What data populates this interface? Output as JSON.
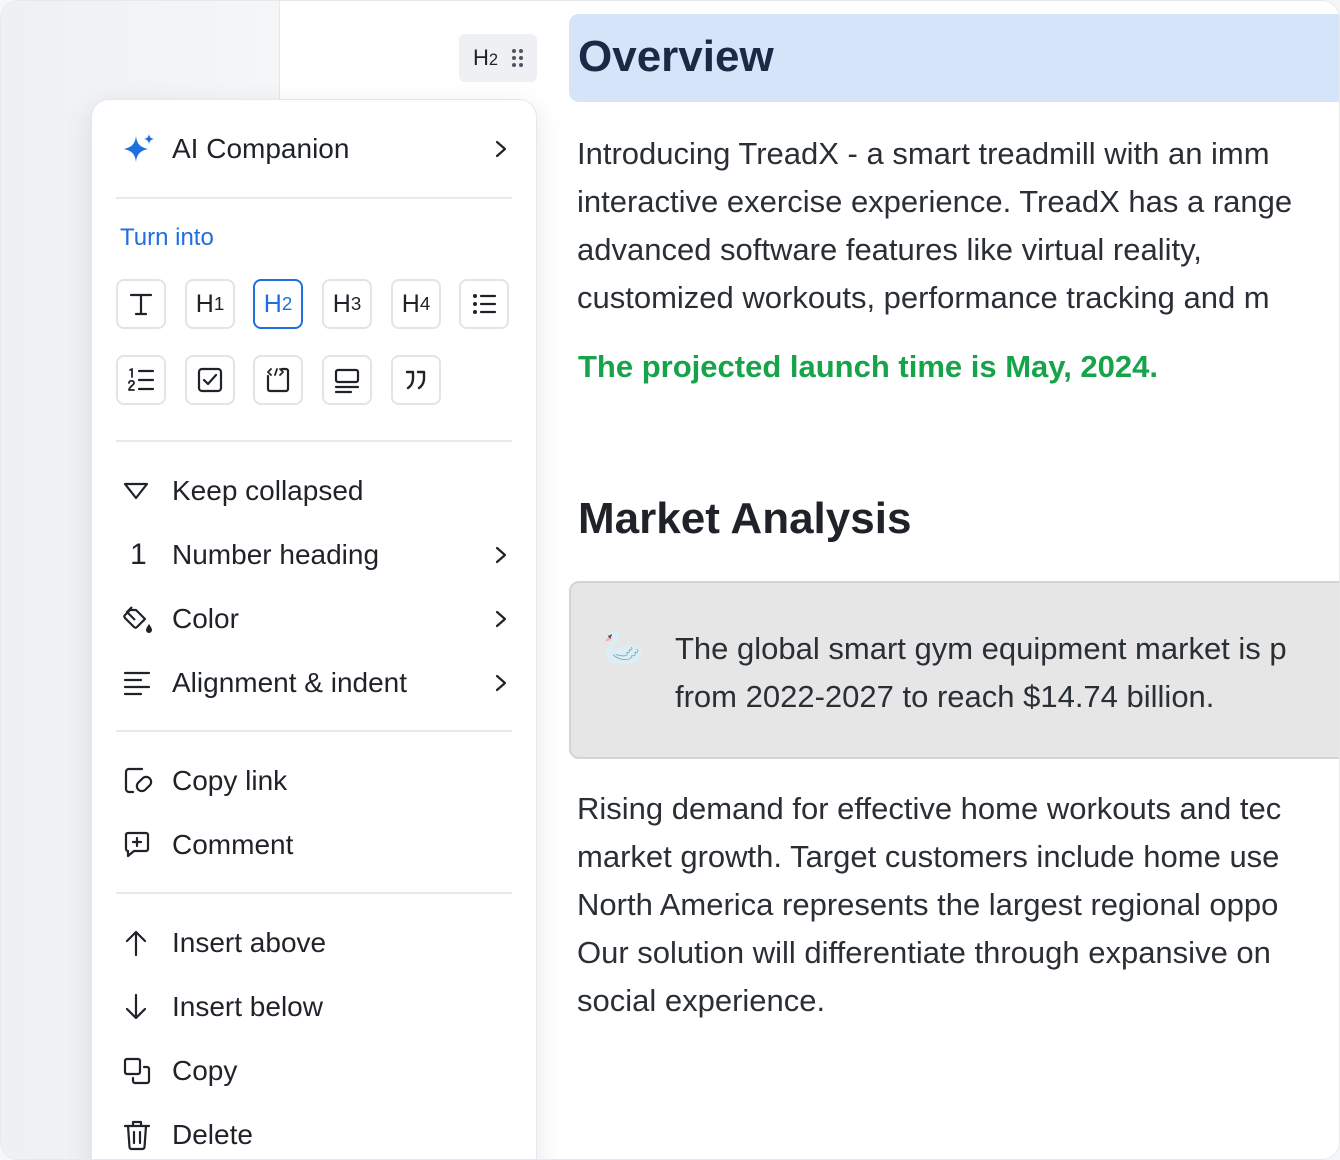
{
  "handle": {
    "tag": "H",
    "tag_sub": "2"
  },
  "doc": {
    "heading": "Overview",
    "intro_lines": [
      "Introducing TreadX - a smart treadmill with an imm",
      "interactive exercise experience. TreadX has a range",
      "advanced software features like virtual reality,",
      "customized workouts, performance tracking and m"
    ],
    "launch_note": "The projected launch time is May, 2024.",
    "section_heading": "Market Analysis",
    "callout": {
      "emoji": "🦢",
      "lines": [
        "The global smart gym equipment market is p",
        "from 2022-2027 to reach $14.74 billion."
      ]
    },
    "body_lines": [
      "Rising demand for effective home workouts and tec",
      "market growth. Target customers include home use",
      "North America represents the largest regional oppo",
      "Our solution will differentiate through expansive on",
      "social experience."
    ]
  },
  "menu": {
    "ai": "AI Companion",
    "turn_into": "Turn into",
    "types": [
      {
        "id": "text",
        "label": "T",
        "sub": ""
      },
      {
        "id": "h1",
        "label": "H",
        "sub": "1"
      },
      {
        "id": "h2",
        "label": "H",
        "sub": "2"
      },
      {
        "id": "h3",
        "label": "H",
        "sub": "3"
      },
      {
        "id": "h4",
        "label": "H",
        "sub": "4"
      }
    ],
    "keep_collapsed": "Keep collapsed",
    "number_heading": "Number heading",
    "number_icon": "1",
    "color": "Color",
    "alignment": "Alignment & indent",
    "copy_link": "Copy link",
    "comment": "Comment",
    "insert_above": "Insert above",
    "insert_below": "Insert below",
    "copy": "Copy",
    "delete": "Delete"
  },
  "colors": {
    "accent": "#1f6fe0",
    "heading_bg": "#d6e4fa",
    "launch_green": "#16a34a",
    "callout_bg": "#e6e6e6"
  }
}
